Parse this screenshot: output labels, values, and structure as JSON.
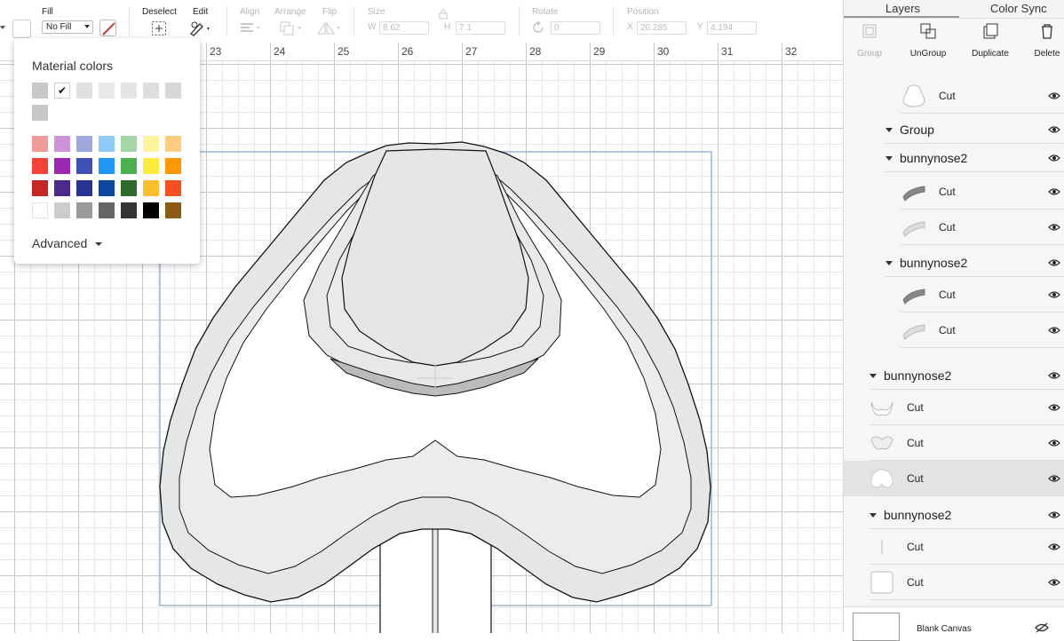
{
  "toolbar": {
    "fill_label": "Fill",
    "fill_select": "No Fill",
    "deselect_label": "Deselect",
    "edit_label": "Edit",
    "align_label": "Align",
    "arrange_label": "Arrange",
    "flip_label": "Flip",
    "size_label": "Size",
    "w_label": "W",
    "w_value": "8.62",
    "h_label": "H",
    "h_value": "7.1",
    "rotate_label": "Rotate",
    "rotate_value": "0",
    "position_label": "Position",
    "x_label": "X",
    "x_value": "20.285",
    "y_label": "Y",
    "y_value": "4.194"
  },
  "ruler": {
    "numbers": [
      "23",
      "24",
      "25",
      "26",
      "27",
      "28",
      "29",
      "30",
      "31",
      "32"
    ]
  },
  "color_popup": {
    "title": "Material colors",
    "advanced_label": "Advanced",
    "greys": [
      "#c8c8c8",
      "#ffffff",
      "#e0e0e0",
      "#e8e8e8",
      "#e4e4e4",
      "#dedede",
      "#d8d8d8",
      "#c6c6c6"
    ],
    "palette": [
      [
        "#ef9a9a",
        "#ce93d8",
        "#9fa8da",
        "#90caf9",
        "#a5d6a7",
        "#fff59d",
        "#ffcc80"
      ],
      [
        "#f44336",
        "#9c27b0",
        "#3f51b5",
        "#2196f3",
        "#4caf50",
        "#ffeb3b",
        "#ff9800"
      ],
      [
        "#c62828",
        "#4a2a8a",
        "#283593",
        "#0d47a1",
        "#2e6b2a",
        "#fbc02d",
        "#f4511e"
      ],
      [
        "#ffffff",
        "#cccccc",
        "#9a9a9a",
        "#666666",
        "#333333",
        "#000000",
        "#8b5a14"
      ]
    ]
  },
  "panel": {
    "tabs": [
      "Layers",
      "Color Sync"
    ],
    "actions": [
      {
        "label": "Group",
        "icon": "group-icon"
      },
      {
        "label": "UnGroup",
        "icon": "ungroup-icon"
      },
      {
        "label": "Duplicate",
        "icon": "duplicate-icon"
      },
      {
        "label": "Delete",
        "icon": "trash-icon"
      }
    ],
    "layers": [
      {
        "label": "Cut"
      },
      {
        "label": "Group"
      },
      {
        "label": "bunnynose2"
      },
      {
        "label": "Cut"
      },
      {
        "label": "Cut"
      },
      {
        "label": "bunnynose2"
      },
      {
        "label": "Cut"
      },
      {
        "label": "Cut"
      },
      {
        "label": "bunnynose2"
      },
      {
        "label": "Cut"
      },
      {
        "label": "Cut"
      },
      {
        "label": "Cut"
      },
      {
        "label": "bunnynose2"
      },
      {
        "label": "Cut"
      },
      {
        "label": "Cut"
      }
    ],
    "blank_canvas_label": "Blank Canvas"
  },
  "colors": {
    "accent": "#c0392b",
    "selection_box": "#9bb7d4"
  }
}
